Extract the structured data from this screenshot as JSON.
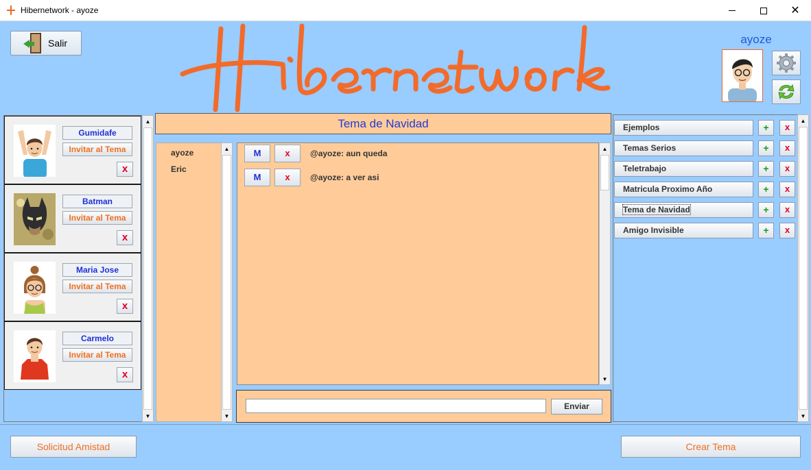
{
  "window": {
    "title": "Hibernetwork - ayoze"
  },
  "header": {
    "exit_label": "Salir",
    "logo_text": "Hibernetwork",
    "user_name": "ayoze"
  },
  "friends": [
    {
      "name": "Gumidafe",
      "invite": "Invitar al Tema",
      "delete": "x"
    },
    {
      "name": "Batman",
      "invite": "Invitar al Tema",
      "delete": "x"
    },
    {
      "name": "Maria Jose",
      "invite": "Invitar al Tema",
      "delete": "x"
    },
    {
      "name": "Carmelo",
      "invite": "Invitar al Tema",
      "delete": "x"
    }
  ],
  "topic": {
    "title": "Tema de Navidad",
    "members": [
      "ayoze",
      "Eric"
    ],
    "messages": [
      {
        "m_label": "M",
        "x_label": "x",
        "text": "@ayoze: aun queda"
      },
      {
        "m_label": "M",
        "x_label": "x",
        "text": "@ayoze: a ver asi"
      }
    ],
    "input_value": "",
    "send_label": "Enviar"
  },
  "topics": [
    {
      "name": "Ejemplos",
      "plus": "+",
      "x": "x"
    },
    {
      "name": "Temas Serios",
      "plus": "+",
      "x": "x"
    },
    {
      "name": "Teletrabajo",
      "plus": "+",
      "x": "x"
    },
    {
      "name": "Matricula Proximo Año",
      "plus": "+",
      "x": "x"
    },
    {
      "name": "Tema de Navidad",
      "plus": "+",
      "x": "x"
    },
    {
      "name": "Amigo Invisible",
      "plus": "+",
      "x": "x"
    }
  ],
  "bottom": {
    "friend_request_label": "Solicitud Amistad",
    "create_topic_label": "Crear Tema"
  },
  "colors": {
    "background": "#99ccff",
    "panel": "#ffcc99",
    "logo": "#f26b2a",
    "accent_blue": "#1f3ad6",
    "accent_orange": "#f07020",
    "delete_red": "#e0002a",
    "add_green": "#1c9a1c"
  },
  "icons": {
    "exit": "door-exit-icon",
    "settings": "gear-icon",
    "refresh": "refresh-icon",
    "app": "app-icon"
  }
}
